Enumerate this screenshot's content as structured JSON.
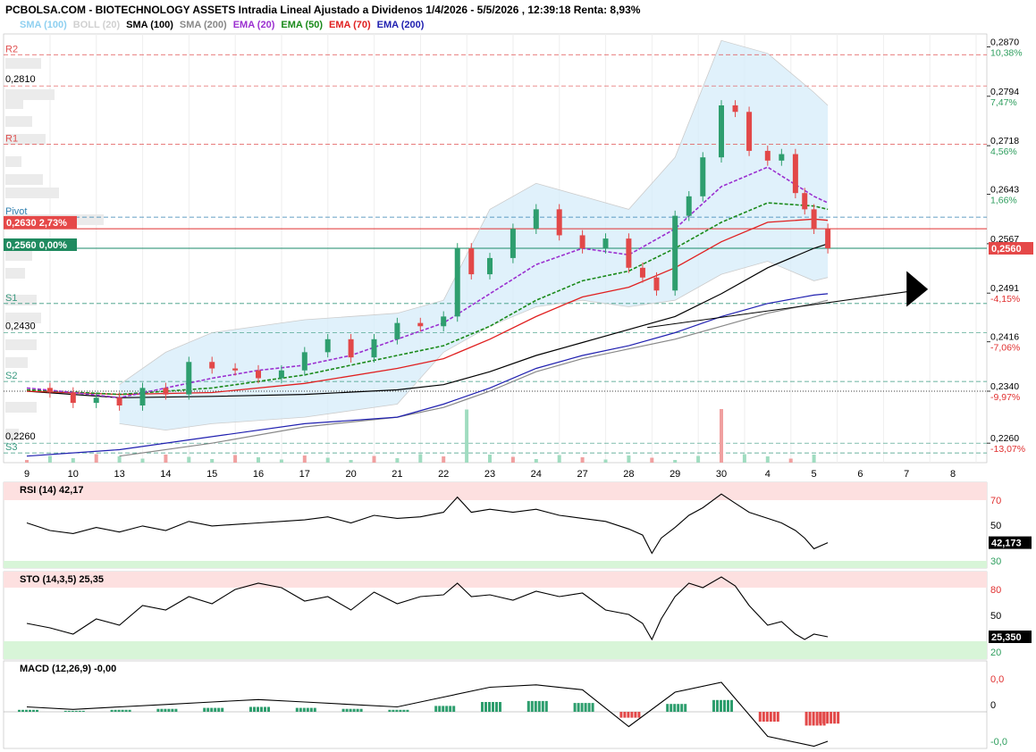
{
  "title": "PCBOLSA.COM - BIOTECHNOLOGY ASSETS Intradia Lineal Ajustado a Dividenos 1/4/2026 - 5/5/2026 , 12:39:18 Renta: 8,93%",
  "legend": [
    {
      "label": "SMA (100)",
      "color": "#8fd0f0"
    },
    {
      "label": "BOLL (20)",
      "color": "#d0d0d0"
    },
    {
      "label": "SMA (100)",
      "color": "#000000"
    },
    {
      "label": "SMA (200)",
      "color": "#888888"
    },
    {
      "label": "EMA (20)",
      "color": "#9b30d0"
    },
    {
      "label": "EMA (50)",
      "color": "#1a8a1a"
    },
    {
      "label": "EMA (70)",
      "color": "#e02020"
    },
    {
      "label": "EMA (200)",
      "color": "#2020b0"
    }
  ],
  "levels": {
    "R2": {
      "label": "R2",
      "value": 0.2858
    },
    "R1": {
      "label": "R1",
      "value": 0.272
    },
    "Pivot": {
      "label": "Pivot",
      "value": 0.2608
    },
    "S1": {
      "label": "S1",
      "value": 0.2475
    },
    "S2": {
      "label": "S2",
      "value": 0.2355
    },
    "S3": {
      "label": "S3",
      "value": 0.2245
    }
  },
  "left_labels": {
    "l2810": "0,2810",
    "l2430": "0,2430",
    "l2260": "0,2260"
  },
  "current_box": {
    "price": "0,2630",
    "pct": "2,73%"
  },
  "base_box": {
    "price": "0,2560",
    "pct": "0,00%"
  },
  "right_axis": [
    {
      "price": "0,2870",
      "pct": "10,38%",
      "pct_color": "#2e9e5e",
      "value": 0.287
    },
    {
      "price": "0,2794",
      "pct": "7,47%",
      "pct_color": "#2e9e5e",
      "value": 0.2794
    },
    {
      "price": "0,2718",
      "pct": "4,56%",
      "pct_color": "#2e9e5e",
      "value": 0.2718
    },
    {
      "price": "0,2643",
      "pct": "1,66%",
      "pct_color": "#2e9e5e",
      "value": 0.2643
    },
    {
      "price": "0,2567",
      "pct": "",
      "pct_color": "#2e9e5e",
      "value": 0.2567
    },
    {
      "price": "0,2491",
      "pct": "-4,15%",
      "pct_color": "#e03030",
      "value": 0.2491
    },
    {
      "price": "0,2416",
      "pct": "-7,06%",
      "pct_color": "#e03030",
      "value": 0.2416
    },
    {
      "price": "0,2340",
      "pct": "-9,97%",
      "pct_color": "#e03030",
      "value": 0.234
    },
    {
      "price": "0,2260",
      "pct": "-13,07%",
      "pct_color": "#e03030",
      "value": 0.226
    }
  ],
  "last_price_tag": "0,2560",
  "x_axis_labels": [
    "9",
    "10",
    "13",
    "14",
    "15",
    "16",
    "17",
    "20",
    "21",
    "22",
    "23",
    "24",
    "27",
    "28",
    "29",
    "30",
    "4",
    "5",
    "6",
    "7",
    "8"
  ],
  "rsi": {
    "label": "RSI (14)",
    "value": "42,17",
    "tag": "42,173",
    "levels": [
      "70",
      "50",
      "30"
    ]
  },
  "sto": {
    "label": "STO (14,3,5)",
    "value": "25,35",
    "tag": "25,350",
    "levels": [
      "80",
      "50",
      "20"
    ]
  },
  "macd": {
    "label": "MACD (12,26,9)",
    "value": "-0,00",
    "levels": [
      "0,0",
      "0",
      "-0,0"
    ]
  },
  "chart_data": {
    "type": "candlestick",
    "x_unit": "trading session index (0 = Apr 9)",
    "price_range": [
      0.223,
      0.289
    ],
    "close_path": [
      [
        0.0,
        0.2345
      ],
      [
        0.5,
        0.2338
      ],
      [
        1.0,
        0.2322
      ],
      [
        1.5,
        0.233
      ],
      [
        2.0,
        0.2318
      ],
      [
        2.5,
        0.2345
      ],
      [
        3.0,
        0.2335
      ],
      [
        3.5,
        0.2385
      ],
      [
        4.0,
        0.2375
      ],
      [
        4.5,
        0.2372
      ],
      [
        5.0,
        0.236
      ],
      [
        5.5,
        0.2372
      ],
      [
        6.0,
        0.24
      ],
      [
        6.5,
        0.242
      ],
      [
        7.0,
        0.2392
      ],
      [
        7.5,
        0.242
      ],
      [
        8.0,
        0.2445
      ],
      [
        8.5,
        0.244
      ],
      [
        9.0,
        0.2455
      ],
      [
        9.3,
        0.256
      ],
      [
        9.6,
        0.252
      ],
      [
        10.0,
        0.2545
      ],
      [
        10.5,
        0.259
      ],
      [
        11.0,
        0.262
      ],
      [
        11.5,
        0.258
      ],
      [
        12.0,
        0.256
      ],
      [
        12.5,
        0.2575
      ],
      [
        13.0,
        0.253
      ],
      [
        13.3,
        0.2515
      ],
      [
        13.6,
        0.2495
      ],
      [
        14.0,
        0.261
      ],
      [
        14.3,
        0.264
      ],
      [
        14.6,
        0.27
      ],
      [
        15.0,
        0.278
      ],
      [
        15.3,
        0.277
      ],
      [
        15.6,
        0.271
      ],
      [
        16.0,
        0.2695
      ],
      [
        16.3,
        0.2705
      ],
      [
        16.6,
        0.2645
      ],
      [
        16.8,
        0.262
      ],
      [
        17.0,
        0.259
      ],
      [
        17.3,
        0.256
      ]
    ],
    "ema20": [
      [
        0,
        0.2345
      ],
      [
        1,
        0.2338
      ],
      [
        2,
        0.233
      ],
      [
        3,
        0.2345
      ],
      [
        4,
        0.236
      ],
      [
        5,
        0.2372
      ],
      [
        6,
        0.238
      ],
      [
        7,
        0.2395
      ],
      [
        8,
        0.242
      ],
      [
        9,
        0.2445
      ],
      [
        10,
        0.249
      ],
      [
        11,
        0.2535
      ],
      [
        12,
        0.256
      ],
      [
        13,
        0.255
      ],
      [
        14,
        0.259
      ],
      [
        15,
        0.2655
      ],
      [
        16,
        0.2685
      ],
      [
        17,
        0.264
      ],
      [
        17.3,
        0.263
      ]
    ],
    "ema50": [
      [
        0,
        0.2342
      ],
      [
        2,
        0.2335
      ],
      [
        4,
        0.2345
      ],
      [
        6,
        0.2365
      ],
      [
        8,
        0.2395
      ],
      [
        9,
        0.241
      ],
      [
        10,
        0.244
      ],
      [
        11,
        0.248
      ],
      [
        12,
        0.251
      ],
      [
        13,
        0.2525
      ],
      [
        14,
        0.256
      ],
      [
        15,
        0.26
      ],
      [
        16,
        0.263
      ],
      [
        17,
        0.2625
      ],
      [
        17.3,
        0.262
      ]
    ],
    "ema70": [
      [
        0,
        0.234
      ],
      [
        2,
        0.2335
      ],
      [
        4,
        0.2338
      ],
      [
        6,
        0.2352
      ],
      [
        8,
        0.2375
      ],
      [
        9,
        0.239
      ],
      [
        10,
        0.242
      ],
      [
        11,
        0.2455
      ],
      [
        12,
        0.2485
      ],
      [
        13,
        0.25
      ],
      [
        14,
        0.253
      ],
      [
        15,
        0.257
      ],
      [
        16,
        0.26
      ],
      [
        17,
        0.2605
      ],
      [
        17.3,
        0.2603
      ]
    ],
    "sma100": [
      [
        0,
        0.234
      ],
      [
        2,
        0.233
      ],
      [
        4,
        0.2332
      ],
      [
        6,
        0.2335
      ],
      [
        8,
        0.2342
      ],
      [
        9,
        0.235
      ],
      [
        10,
        0.237
      ],
      [
        11,
        0.2395
      ],
      [
        12,
        0.2415
      ],
      [
        13,
        0.2435
      ],
      [
        14,
        0.2455
      ],
      [
        15,
        0.249
      ],
      [
        16,
        0.253
      ],
      [
        17,
        0.256
      ],
      [
        17.3,
        0.2567
      ]
    ],
    "ema200": [
      [
        0,
        0.224
      ],
      [
        2,
        0.225
      ],
      [
        4,
        0.227
      ],
      [
        6,
        0.229
      ],
      [
        8,
        0.23
      ],
      [
        9,
        0.232
      ],
      [
        10,
        0.2345
      ],
      [
        11,
        0.2375
      ],
      [
        12,
        0.2395
      ],
      [
        13,
        0.241
      ],
      [
        14,
        0.243
      ],
      [
        15,
        0.2455
      ],
      [
        16,
        0.2475
      ],
      [
        17,
        0.2488
      ],
      [
        17.3,
        0.249
      ]
    ],
    "sma200": [
      [
        2,
        0.224
      ],
      [
        4,
        0.226
      ],
      [
        6,
        0.2285
      ],
      [
        8,
        0.23
      ],
      [
        9,
        0.2315
      ],
      [
        10,
        0.234
      ],
      [
        11,
        0.237
      ],
      [
        12,
        0.239
      ],
      [
        13,
        0.2405
      ],
      [
        14,
        0.242
      ],
      [
        15,
        0.244
      ],
      [
        16,
        0.246
      ],
      [
        17,
        0.2475
      ],
      [
        17.3,
        0.248
      ]
    ],
    "boll_upper": [
      [
        2,
        0.235
      ],
      [
        3,
        0.24
      ],
      [
        4,
        0.243
      ],
      [
        6,
        0.245
      ],
      [
        8,
        0.246
      ],
      [
        9,
        0.248
      ],
      [
        10,
        0.262
      ],
      [
        11,
        0.266
      ],
      [
        12,
        0.264
      ],
      [
        13,
        0.262
      ],
      [
        14,
        0.27
      ],
      [
        15,
        0.288
      ],
      [
        16,
        0.286
      ],
      [
        17,
        0.28
      ],
      [
        17.3,
        0.278
      ]
    ],
    "boll_lower": [
      [
        2,
        0.229
      ],
      [
        3,
        0.228
      ],
      [
        4,
        0.229
      ],
      [
        6,
        0.23
      ],
      [
        8,
        0.232
      ],
      [
        9,
        0.24
      ],
      [
        10,
        0.244
      ],
      [
        11,
        0.247
      ],
      [
        12,
        0.248
      ],
      [
        13,
        0.247
      ],
      [
        14,
        0.248
      ],
      [
        15,
        0.252
      ],
      [
        16,
        0.254
      ],
      [
        17,
        0.251
      ],
      [
        17.3,
        0.2515
      ]
    ],
    "rsi_values": [
      [
        0,
        55
      ],
      [
        0.5,
        50
      ],
      [
        1,
        48
      ],
      [
        1.5,
        52
      ],
      [
        2,
        49
      ],
      [
        2.5,
        53
      ],
      [
        3,
        50
      ],
      [
        3.5,
        56
      ],
      [
        4,
        53
      ],
      [
        4.5,
        54
      ],
      [
        5,
        55
      ],
      [
        5.5,
        56
      ],
      [
        6,
        57
      ],
      [
        6.5,
        59
      ],
      [
        7,
        55
      ],
      [
        7.5,
        60
      ],
      [
        8,
        58
      ],
      [
        8.5,
        59
      ],
      [
        9,
        62
      ],
      [
        9.3,
        72
      ],
      [
        9.6,
        62
      ],
      [
        10,
        64
      ],
      [
        10.5,
        62
      ],
      [
        11,
        64
      ],
      [
        11.5,
        60
      ],
      [
        12,
        58
      ],
      [
        12.5,
        56
      ],
      [
        13,
        51
      ],
      [
        13.3,
        47
      ],
      [
        13.5,
        35
      ],
      [
        13.7,
        45
      ],
      [
        14,
        52
      ],
      [
        14.3,
        60
      ],
      [
        14.6,
        65
      ],
      [
        15,
        74
      ],
      [
        15.3,
        68
      ],
      [
        15.6,
        62
      ],
      [
        16,
        58
      ],
      [
        16.3,
        55
      ],
      [
        16.6,
        50
      ],
      [
        16.8,
        45
      ],
      [
        17,
        38
      ],
      [
        17.3,
        42
      ]
    ],
    "sto_k": [
      [
        0,
        40
      ],
      [
        0.5,
        35
      ],
      [
        1,
        28
      ],
      [
        1.5,
        45
      ],
      [
        2,
        38
      ],
      [
        2.5,
        60
      ],
      [
        3,
        55
      ],
      [
        3.5,
        70
      ],
      [
        4,
        62
      ],
      [
        4.5,
        78
      ],
      [
        5,
        85
      ],
      [
        5.5,
        80
      ],
      [
        6,
        65
      ],
      [
        6.5,
        70
      ],
      [
        7,
        55
      ],
      [
        7.5,
        75
      ],
      [
        8,
        62
      ],
      [
        8.5,
        70
      ],
      [
        9,
        72
      ],
      [
        9.3,
        85
      ],
      [
        9.6,
        70
      ],
      [
        10,
        72
      ],
      [
        10.5,
        66
      ],
      [
        11,
        76
      ],
      [
        11.5,
        70
      ],
      [
        12,
        74
      ],
      [
        12.5,
        55
      ],
      [
        13,
        50
      ],
      [
        13.3,
        40
      ],
      [
        13.5,
        22
      ],
      [
        13.7,
        45
      ],
      [
        14,
        70
      ],
      [
        14.3,
        85
      ],
      [
        14.6,
        80
      ],
      [
        15,
        92
      ],
      [
        15.3,
        82
      ],
      [
        15.6,
        60
      ],
      [
        16,
        38
      ],
      [
        16.3,
        42
      ],
      [
        16.6,
        28
      ],
      [
        16.8,
        22
      ],
      [
        17,
        28
      ],
      [
        17.3,
        25
      ]
    ],
    "macd_hist": [
      [
        0,
        0.1
      ],
      [
        1,
        0.05
      ],
      [
        2,
        0.1
      ],
      [
        3,
        0.15
      ],
      [
        4,
        0.2
      ],
      [
        5,
        0.25
      ],
      [
        6,
        0.2
      ],
      [
        7,
        0.15
      ],
      [
        8,
        0.1
      ],
      [
        9,
        0.3
      ],
      [
        10,
        0.5
      ],
      [
        11,
        0.55
      ],
      [
        12,
        0.45
      ],
      [
        13,
        -0.3
      ],
      [
        14,
        0.4
      ],
      [
        15,
        0.6
      ],
      [
        16,
        -0.5
      ],
      [
        17,
        -0.7
      ],
      [
        17.3,
        -0.6
      ]
    ],
    "x_ticks": [
      "9",
      "10",
      "13",
      "14",
      "15",
      "16",
      "17",
      "20",
      "21",
      "22",
      "23",
      "24",
      "27",
      "28",
      "29",
      "30",
      "4",
      "5",
      "6",
      "7",
      "8"
    ]
  }
}
